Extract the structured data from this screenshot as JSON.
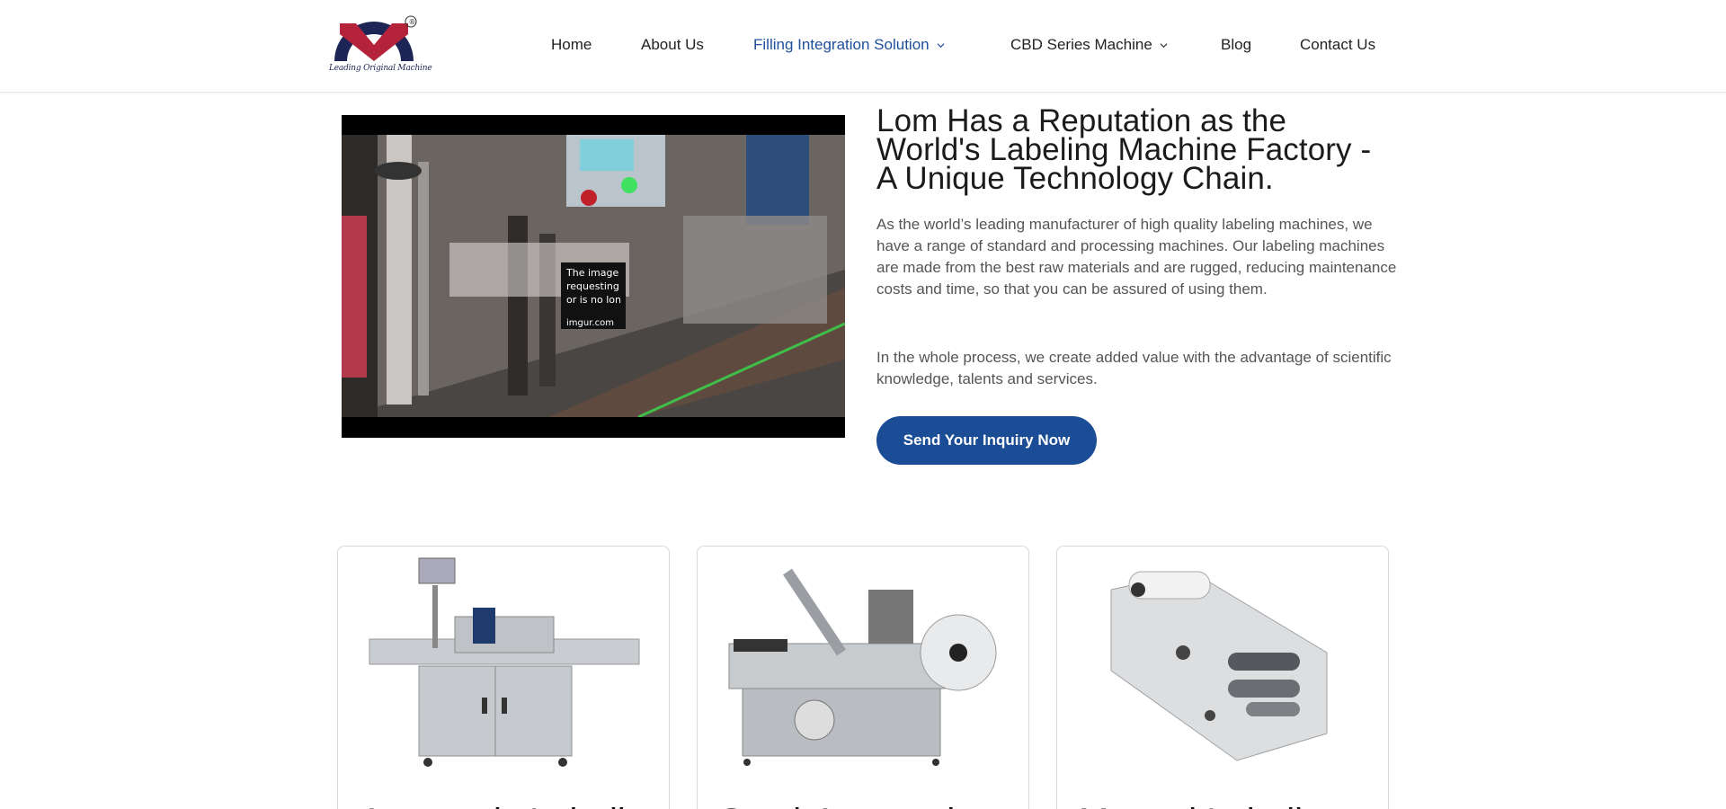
{
  "header": {
    "logo_tagline": "Leading Original Machine",
    "logo_mark": "®",
    "nav": [
      {
        "label": "Home",
        "active": false,
        "dropdown": false
      },
      {
        "label": "About Us",
        "active": false,
        "dropdown": false
      },
      {
        "label": "Filling Integration Solution",
        "active": true,
        "dropdown": true
      },
      {
        "label": "CBD Series Machine",
        "active": false,
        "dropdown": true
      },
      {
        "label": "Blog",
        "active": false,
        "dropdown": false
      },
      {
        "label": "Contact Us",
        "active": false,
        "dropdown": false
      }
    ]
  },
  "video": {
    "error_lines": [
      "The image",
      "requesting",
      "or is no lon"
    ],
    "error_host": "imgur.com"
  },
  "intro": {
    "headline": "Lom Has a Reputation as the World's Labeling Machine Factory - A Unique Technology Chain.",
    "paragraph_1": "As the world’s leading manufacturer of high quality labeling machines, we have a range of standard and processing machines. Our labeling machines are made from the best raw materials and are rugged, reducing maintenance costs and time, so that you can be assured of using them.",
    "paragraph_2": "In the whole process, we create added value with the advantage of scientific knowledge, talents and services.",
    "cta_label": "Send Your Inquiry Now"
  },
  "colors": {
    "accent": "#1e4f9c",
    "button": "#1b4d96",
    "logo_red": "#b5233a",
    "logo_navy": "#1c2556"
  },
  "cards": [
    {
      "title": "Automatic Labeling",
      "icon": "automatic-labeling-machine-image"
    },
    {
      "title": "Semi-Automatic",
      "icon": "semi-automatic-labeling-machine-image"
    },
    {
      "title": "Manual Labeling",
      "icon": "manual-labeling-machine-image"
    }
  ]
}
